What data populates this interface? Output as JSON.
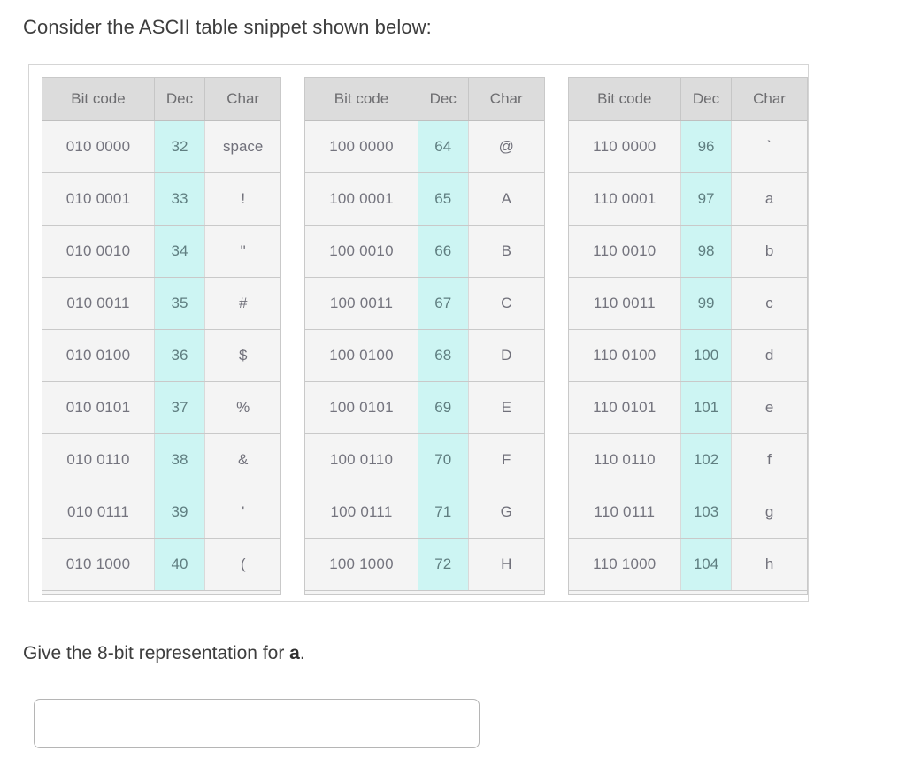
{
  "prompt": {
    "intro": "Consider the ASCII table snippet shown below:",
    "question_prefix": "Give the 8-bit representation for ",
    "question_target": "a",
    "question_suffix": "."
  },
  "table_headers": {
    "bit_code": "Bit code",
    "dec": "Dec",
    "char": "Char"
  },
  "colors": {
    "header_bg": "#dcdcdc",
    "row_bg": "#f4f4f4",
    "dec_highlight": "#cdf5f3",
    "frame_border": "#d5d5d5",
    "text": "#70707a"
  },
  "tables": [
    {
      "id": "table-1",
      "rows": [
        {
          "bit": "010 0000",
          "dec": "32",
          "char": "space"
        },
        {
          "bit": "010 0001",
          "dec": "33",
          "char": "!"
        },
        {
          "bit": "010 0010",
          "dec": "34",
          "char": "\""
        },
        {
          "bit": "010 0011",
          "dec": "35",
          "char": "#"
        },
        {
          "bit": "010 0100",
          "dec": "36",
          "char": "$"
        },
        {
          "bit": "010 0101",
          "dec": "37",
          "char": "%"
        },
        {
          "bit": "010 0110",
          "dec": "38",
          "char": "&"
        },
        {
          "bit": "010 0111",
          "dec": "39",
          "char": "'"
        },
        {
          "bit": "010 1000",
          "dec": "40",
          "char": "("
        }
      ]
    },
    {
      "id": "table-2",
      "rows": [
        {
          "bit": "100 0000",
          "dec": "64",
          "char": "@"
        },
        {
          "bit": "100 0001",
          "dec": "65",
          "char": "A"
        },
        {
          "bit": "100 0010",
          "dec": "66",
          "char": "B"
        },
        {
          "bit": "100 0011",
          "dec": "67",
          "char": "C"
        },
        {
          "bit": "100 0100",
          "dec": "68",
          "char": "D"
        },
        {
          "bit": "100 0101",
          "dec": "69",
          "char": "E"
        },
        {
          "bit": "100 0110",
          "dec": "70",
          "char": "F"
        },
        {
          "bit": "100 0111",
          "dec": "71",
          "char": "G"
        },
        {
          "bit": "100 1000",
          "dec": "72",
          "char": "H"
        }
      ]
    },
    {
      "id": "table-3",
      "rows": [
        {
          "bit": "110 0000",
          "dec": "96",
          "char": "`"
        },
        {
          "bit": "110 0001",
          "dec": "97",
          "char": "a"
        },
        {
          "bit": "110 0010",
          "dec": "98",
          "char": "b"
        },
        {
          "bit": "110 0011",
          "dec": "99",
          "char": "c"
        },
        {
          "bit": "110 0100",
          "dec": "100",
          "char": "d"
        },
        {
          "bit": "110 0101",
          "dec": "101",
          "char": "e"
        },
        {
          "bit": "110 0110",
          "dec": "102",
          "char": "f"
        },
        {
          "bit": "110 0111",
          "dec": "103",
          "char": "g"
        },
        {
          "bit": "110 1000",
          "dec": "104",
          "char": "h"
        }
      ]
    }
  ],
  "answer": {
    "value": "",
    "placeholder": ""
  }
}
